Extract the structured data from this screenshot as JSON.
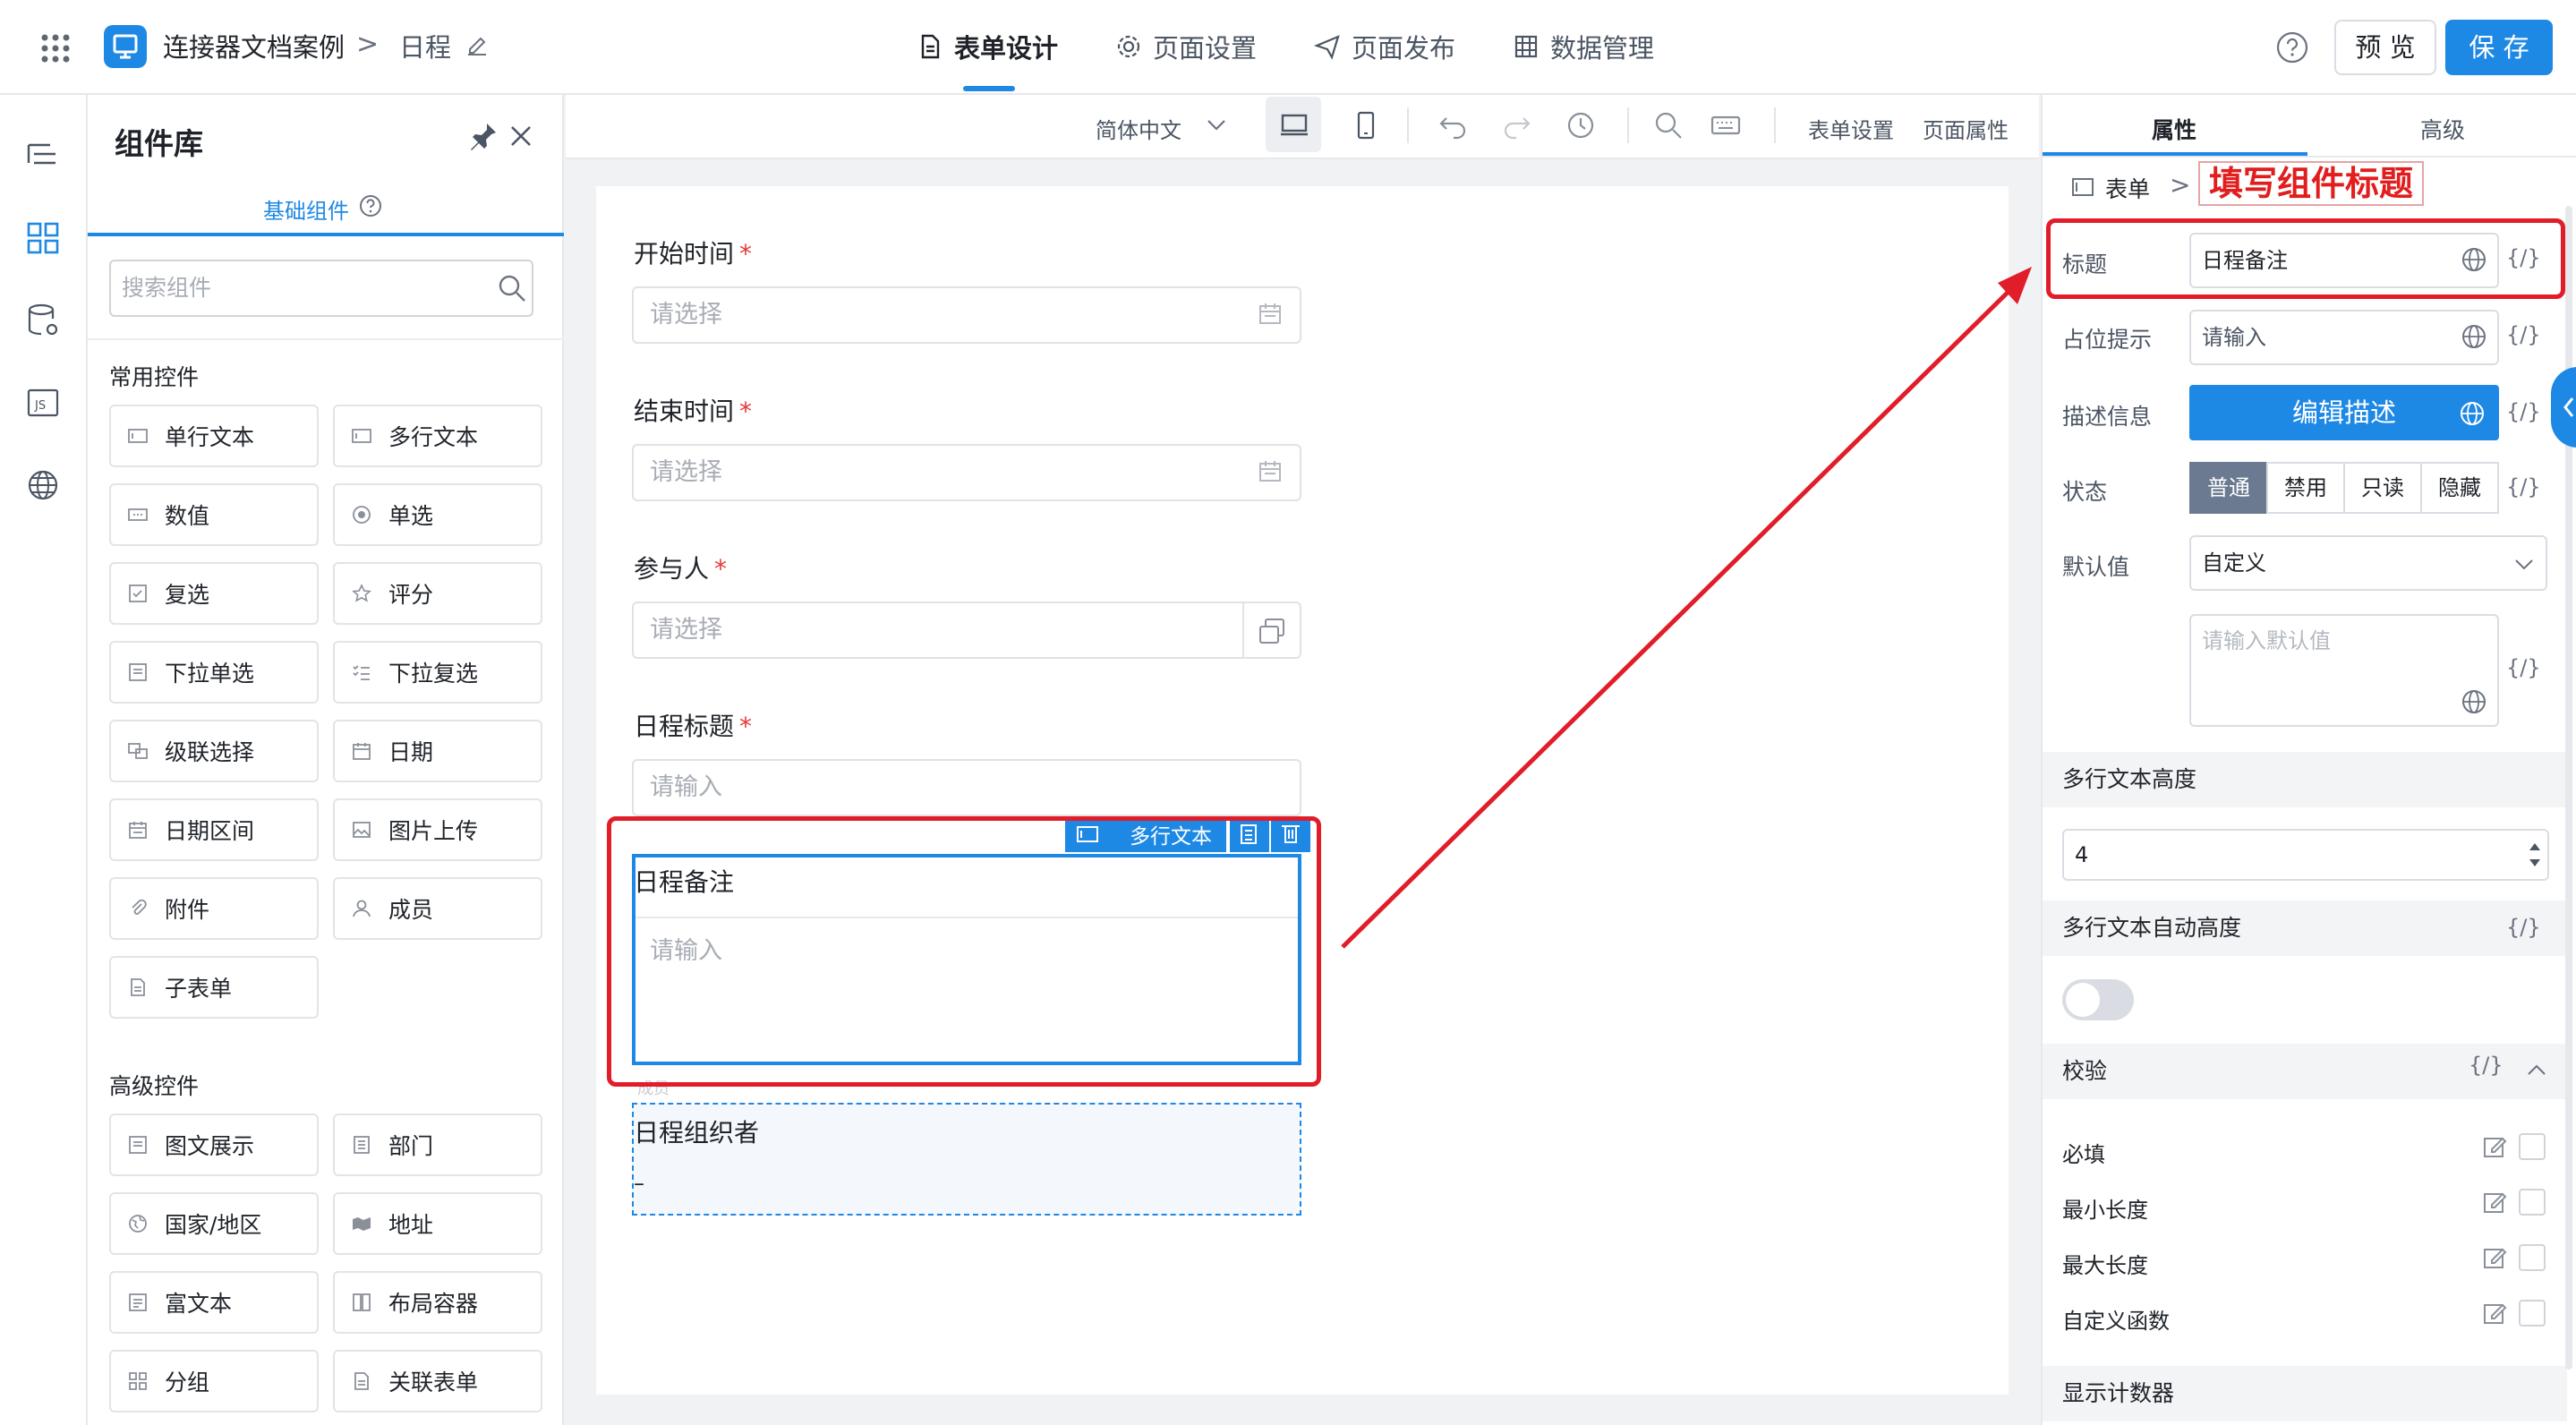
{
  "header": {
    "app_name": "连接器文档案例",
    "crumb_sep": ">",
    "page_name": "日程",
    "tabs": [
      {
        "label": "表单设计",
        "icon": "document-icon",
        "active": true
      },
      {
        "label": "页面设置",
        "icon": "gear-icon",
        "active": false
      },
      {
        "label": "页面发布",
        "icon": "send-icon",
        "active": false
      },
      {
        "label": "数据管理",
        "icon": "grid-icon",
        "active": false
      }
    ],
    "preview_label": "预 览",
    "save_label": "保 存",
    "accent": "#1e88e5"
  },
  "library": {
    "title": "组件库",
    "tab": "基础组件",
    "search_placeholder": "搜索组件",
    "common_title": "常用控件",
    "common": [
      "单行文本",
      "多行文本",
      "数值",
      "单选",
      "复选",
      "评分",
      "下拉单选",
      "下拉复选",
      "级联选择",
      "日期",
      "日期区间",
      "图片上传",
      "附件",
      "成员",
      "子表单"
    ],
    "advanced_title": "高级控件",
    "advanced": [
      "图文展示",
      "部门",
      "国家/地区",
      "地址",
      "富文本",
      "布局容器",
      "分组",
      "关联表单"
    ]
  },
  "toolbar": {
    "language": "简体中文",
    "form_settings": "表单设置",
    "page_props": "页面属性"
  },
  "form": {
    "fields": [
      {
        "label": "开始时间",
        "placeholder": "请选择",
        "required": "*"
      },
      {
        "label": "结束时间",
        "placeholder": "请选择",
        "required": "*"
      },
      {
        "label": "参与人",
        "placeholder": "请选择",
        "required": "*"
      },
      {
        "label": "日程标题",
        "placeholder": "请输入",
        "required": "*"
      }
    ],
    "selected": {
      "tag": "多行文本",
      "label": "日程备注",
      "placeholder": "请输入"
    },
    "next": {
      "small": "成员",
      "label": "日程组织者",
      "value": "–"
    }
  },
  "panel": {
    "tab_props": "属性",
    "tab_advanced": "高级",
    "crumb": "表单",
    "annotation": "填写组件标题",
    "rows": {
      "title_label": "标题",
      "title_value": "日程备注",
      "placeholder_label": "占位提示",
      "placeholder_value": "请输入",
      "desc_label": "描述信息",
      "desc_button": "编辑描述",
      "state_label": "状态",
      "states": [
        "普通",
        "禁用",
        "只读",
        "隐藏"
      ],
      "default_label": "默认值",
      "default_select": "自定义",
      "default_placeholder": "请输入默认值",
      "fx": "{/}"
    },
    "height_section": "多行文本高度",
    "height_value": "4",
    "auto_height_section": "多行文本自动高度",
    "validation_section": "校验",
    "checks": [
      "必填",
      "最小长度",
      "最大长度",
      "自定义函数"
    ],
    "counter_section": "显示计数器"
  }
}
